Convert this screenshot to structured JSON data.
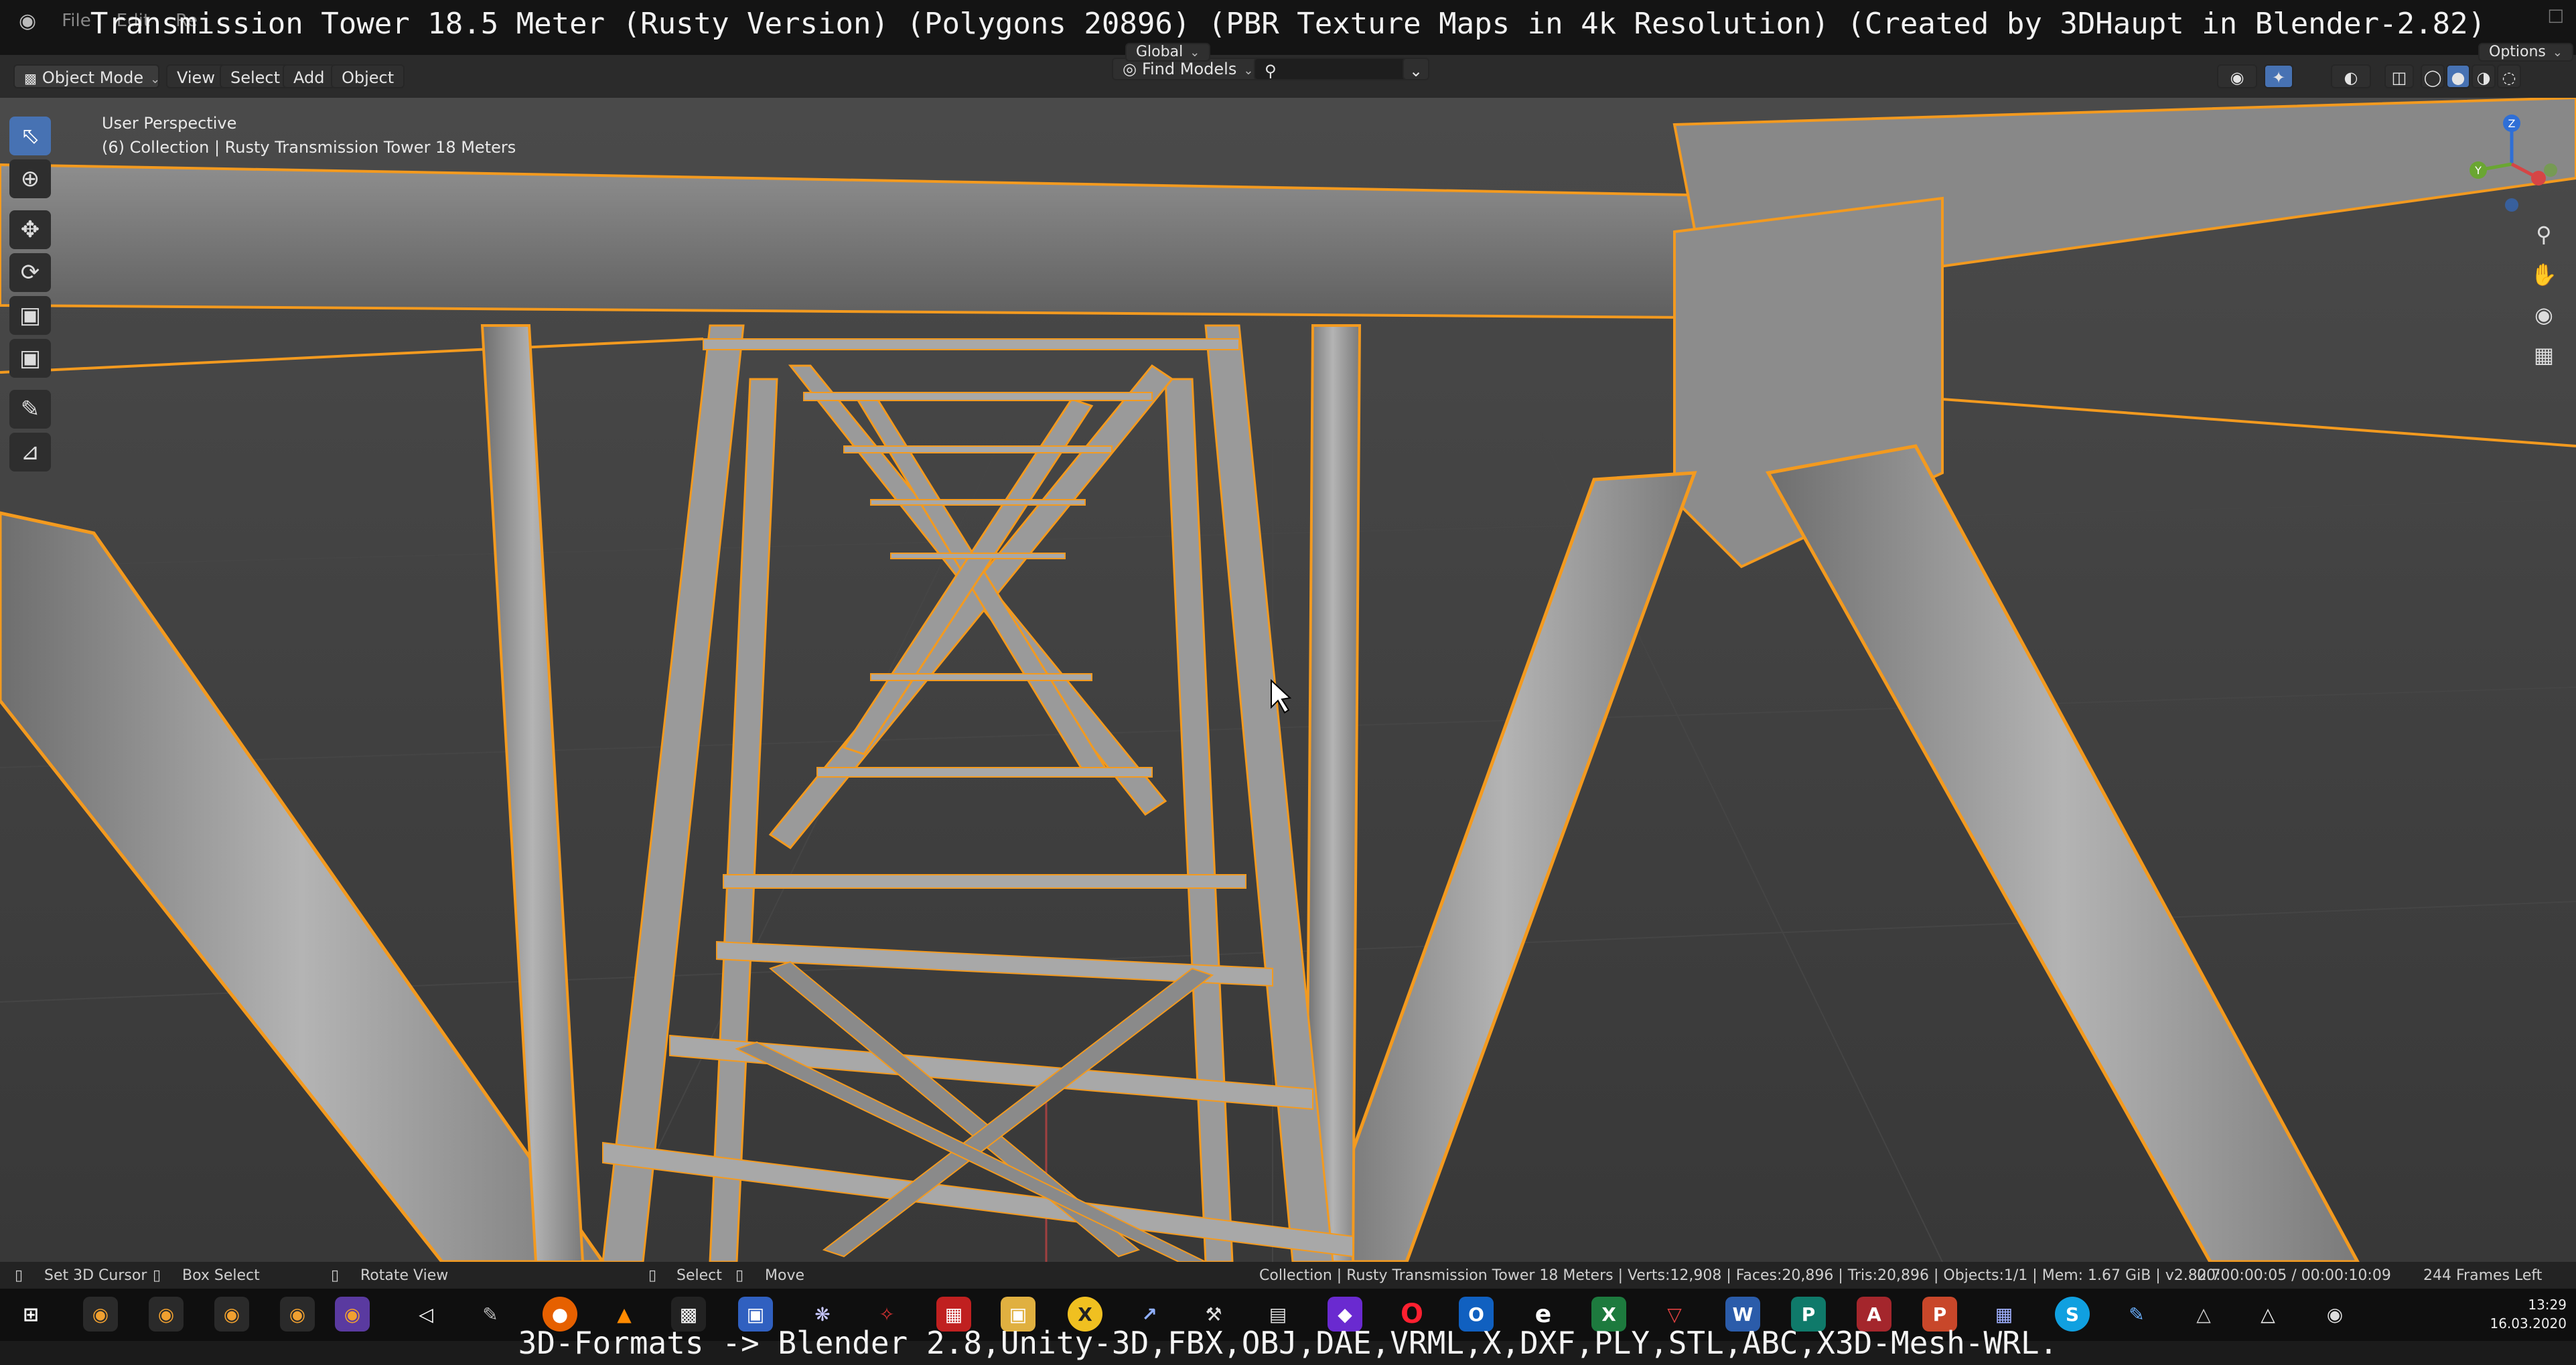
{
  "title_overlay": "Transmission Tower 18.5 Meter (Rusty Version) (Polygons 20896) (PBR Texture Maps in 4k Resolution) (Created by 3DHaupt in Blender-2.82)",
  "top_menu": [
    "File",
    "Edit",
    "Re"
  ],
  "header": {
    "mode": "Object Mode",
    "menus": [
      "View",
      "Select",
      "Add",
      "Object"
    ],
    "orientation": "Global",
    "find_models": "Find Models",
    "search_placeholder": "",
    "options": "Options"
  },
  "viewport": {
    "perspective": "User Perspective",
    "collection": "(6) Collection | Rusty Transmission Tower 18 Meters",
    "gizmo_axes": [
      "Z",
      "Y",
      "X"
    ],
    "colors": {
      "selection_outline": "#f39a1f",
      "background": "#3a3a3a",
      "grid": "#454545",
      "metal": "#9a9a9a"
    }
  },
  "tools": [
    "select-box-icon",
    "cursor-icon",
    "move-icon",
    "rotate-icon",
    "scale-icon",
    "transform-icon",
    "annotate-icon",
    "measure-icon"
  ],
  "nav_icons": [
    "zoom-icon",
    "hand-pan-icon",
    "camera-icon",
    "grid-view-icon"
  ],
  "status_bar": {
    "left_items": [
      "Set 3D Cursor",
      "Box Select",
      "Rotate View",
      "Select",
      "Move"
    ],
    "stats": "Collection | Rusty Transmission Tower 18 Meters | Verts:12,908 | Faces:20,896 | Tris:20,896 | Objects:1/1 | Mem: 1.67 GiB | v2.82.7",
    "timer": "00:00:00:05 / 00:00:10:09",
    "frames_left": "244 Frames Left"
  },
  "taskbar": {
    "time": "13:29",
    "date": "16.03.2020"
  },
  "caption": "3D-Formats -> Blender 2.8,Unity-3D,FBX,OBJ,DAE,VRML,X,DXF,PLY,STL,ABC,X3D-Mesh-WRL."
}
